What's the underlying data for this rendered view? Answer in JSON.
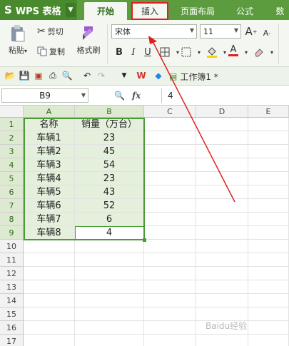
{
  "app": {
    "name": "WPS 表格"
  },
  "tabs": [
    {
      "label": "开始"
    },
    {
      "label": "插入"
    },
    {
      "label": "页面布局"
    },
    {
      "label": "公式"
    },
    {
      "label": "数"
    }
  ],
  "ribbon": {
    "paste_label": "粘贴",
    "cut_label": "剪切",
    "copy_label": "复制",
    "format_painter_label": "格式刷",
    "font_name": "宋体",
    "font_size": "11",
    "bold_label": "B",
    "italic_label": "I",
    "underline_label": "U",
    "grow_font_label": "A",
    "shrink_font_label": "A",
    "font_color_label": "A"
  },
  "quickbar": {
    "document_name": "工作簿1 *"
  },
  "formula_bar": {
    "name_box": "B9",
    "fx_label": "fx",
    "value": "4"
  },
  "sheet": {
    "columns": [
      "A",
      "B",
      "C",
      "D",
      "E"
    ],
    "rows": [
      "1",
      "2",
      "3",
      "4",
      "5",
      "6",
      "7",
      "8",
      "9",
      "10",
      "11",
      "12",
      "13",
      "14",
      "15",
      "16",
      "17"
    ],
    "cells": [
      [
        "名称",
        "销量（万台）"
      ],
      [
        "车辆1",
        "23"
      ],
      [
        "车辆2",
        "45"
      ],
      [
        "车辆3",
        "54"
      ],
      [
        "车辆4",
        "23"
      ],
      [
        "车辆5",
        "43"
      ],
      [
        "车辆6",
        "52"
      ],
      [
        "车辆7",
        "6"
      ],
      [
        "车辆8",
        "4"
      ]
    ]
  },
  "colors": {
    "accent": "#5d9b3f",
    "selection": "#4d9a3a",
    "annotation": "#e02020"
  },
  "watermark": "Baidu经验"
}
